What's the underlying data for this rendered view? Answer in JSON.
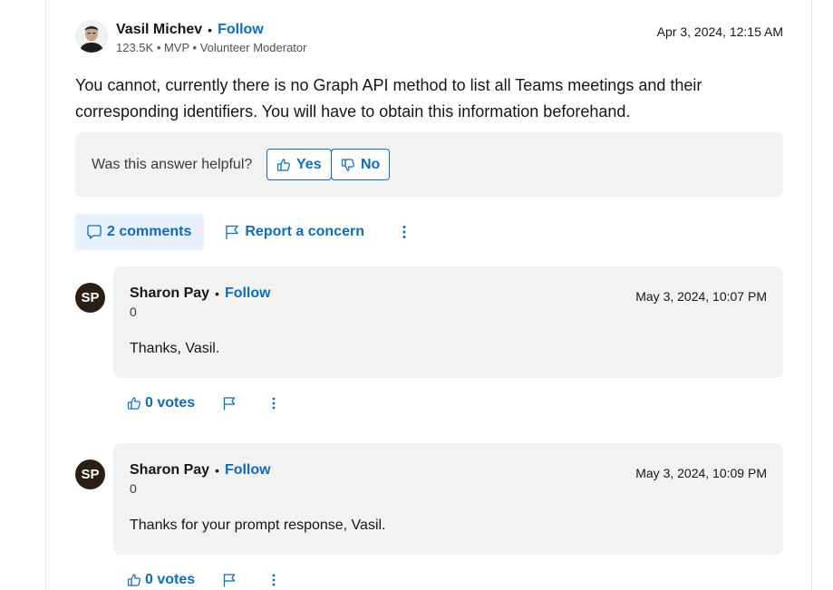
{
  "answer": {
    "author": {
      "name": "Vasil Michev",
      "follow_label": "Follow",
      "meta": "123.5K • MVP • Volunteer Moderator"
    },
    "timestamp": "Apr 3, 2024, 12:15 AM",
    "body": "You cannot, currently there is no Graph API method to list all Teams meetings and their corresponding identifiers. You will have to obtain this information beforehand.",
    "helpful": {
      "question": "Was this answer helpful?",
      "yes_label": "Yes",
      "no_label": "No"
    },
    "actions": {
      "comments_label": "2 comments",
      "report_label": "Report a concern"
    }
  },
  "comments": [
    {
      "initials": "SP",
      "name": "Sharon Pay",
      "follow_label": "Follow",
      "score": "0",
      "timestamp": "May 3, 2024, 10:07 PM",
      "text": "Thanks, Vasil.",
      "votes_label": "0 votes"
    },
    {
      "initials": "SP",
      "name": "Sharon Pay",
      "follow_label": "Follow",
      "score": "0",
      "timestamp": "May 3, 2024, 10:09 PM",
      "text": "Thanks for your prompt response, Vasil.",
      "votes_label": "0 votes"
    }
  ],
  "theme": {
    "accent": "#0f6cbd",
    "panel_bg": "#f2f2f2",
    "avatar_bg": "#2a1f16"
  },
  "icons": {
    "vote_up": "thumbs-up-icon",
    "vote_down": "thumbs-down-icon",
    "comments": "comment-bubble-icon",
    "report": "flag-icon",
    "more": "more-vertical-icon"
  }
}
